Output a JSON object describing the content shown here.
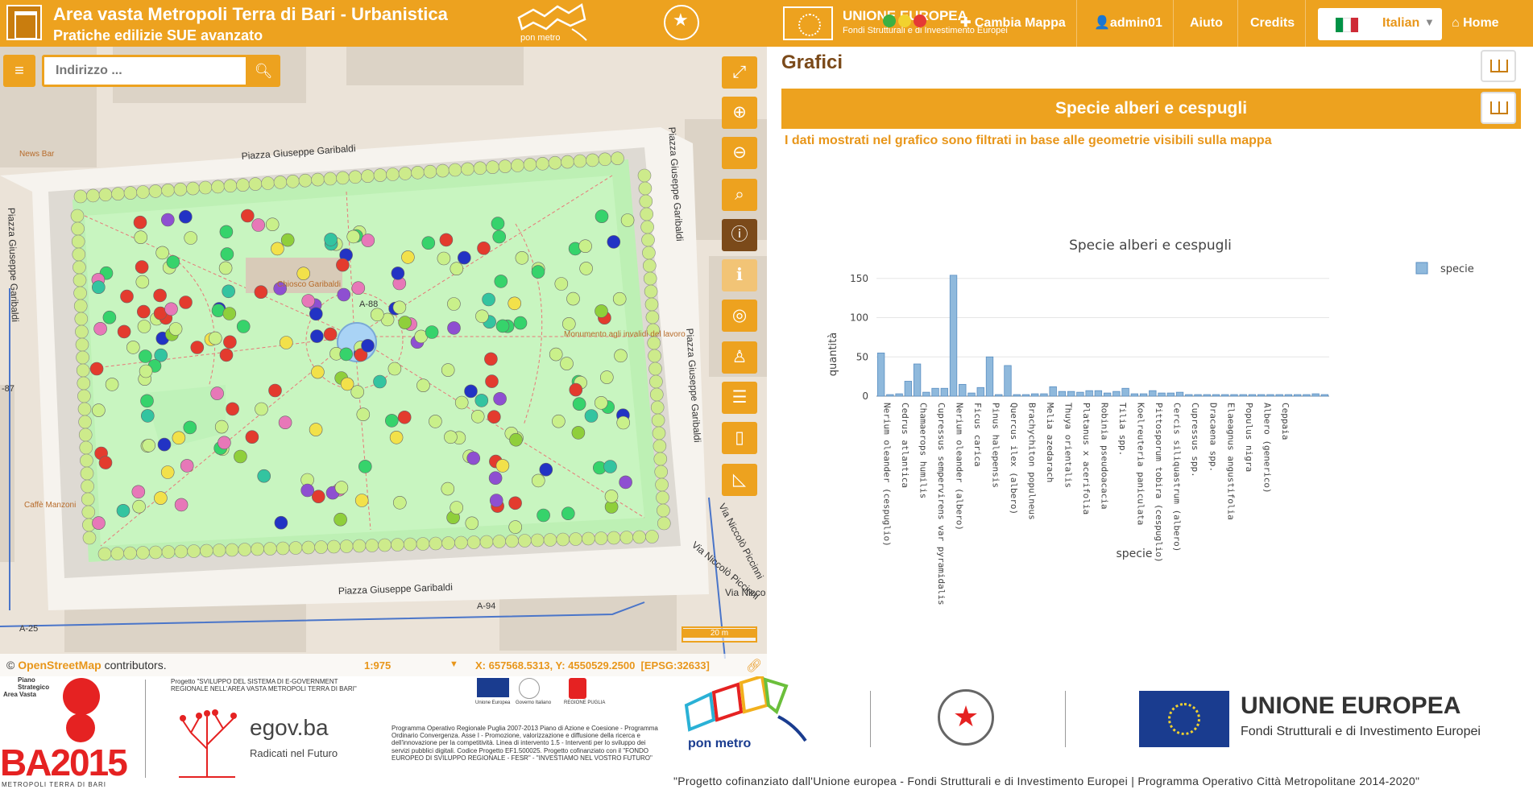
{
  "header": {
    "title": "Area vasta Metropoli Terra di Bari - Urbanistica",
    "subtitle": "Pratiche edilizie SUE avanzato",
    "ponmetro": "pon metro",
    "eu_title": "UNIONE EUROPEA",
    "eu_sub": "Fondi Strutturali e di Investimento Europei",
    "nav": {
      "cambia_mappa": "Cambia Mappa",
      "user": "admin01",
      "aiuto": "Aiuto",
      "credits": "Credits",
      "language": "Italian",
      "home": "Home"
    },
    "colors": {
      "accent": "#eda21f",
      "brown": "#7b4a1a"
    }
  },
  "map": {
    "search_placeholder": "Indirizzo ...",
    "attribution_prefix": "©",
    "attribution_link": "OpenStreetMap",
    "attribution_suffix": "contributors.",
    "scale": "1:975",
    "coords": "X: 657568.5313, Y: 4550529.2500",
    "epsg": "[EPSG:32633]",
    "scalebar": "20 m",
    "labels": {
      "street_top": "Piazza Giuseppe Garibaldi",
      "street_bottom": "Piazza Giuseppe Garibaldi",
      "street_left": "Piazza Giuseppe Garibaldi",
      "street_right_top": "Piazza Giuseppe Garibaldi",
      "street_right": "Piazza Giuseppe Garibaldi",
      "street_piccinni": "Via Niccolò Piccinni",
      "street_piccinni2": "Via Niccolò Piccinni",
      "street_nic": "Via Nicco",
      "kiosk": "Chiosco Garibaldi",
      "monument": "Monumento agli invalidi del lavoro",
      "news_bar": "News Bar",
      "caffe": "Caffè Manzoni",
      "a88": "A-88",
      "a94": "A-94",
      "a25": "A-25",
      "a87": "-87"
    },
    "tools": [
      "fullscreen-icon",
      "zoom-in-icon",
      "zoom-out-icon",
      "zoom-extent-icon",
      "info-icon",
      "info-list-icon",
      "locate-icon",
      "street-view-icon",
      "layers-icon",
      "measure-length-icon",
      "measure-area-icon"
    ]
  },
  "panel": {
    "title": "Grafici",
    "banner": "Specie alberi e cespugli",
    "note": "I dati mostrati nel grafico sono filtrati in base alle geometrie visibili sulla mappa"
  },
  "chart_data": {
    "type": "bar",
    "title": "Specie alberi e cespugli",
    "xlabel": "specie",
    "ylabel": "quantità",
    "ylim": [
      0,
      160
    ],
    "yticks": [
      0,
      50,
      100,
      150
    ],
    "grid": true,
    "legend": "top-right",
    "bar_color": "#8fb9dc",
    "series": [
      {
        "name": "specie"
      }
    ],
    "categories": [
      "Nerium oleander (cespuglio)",
      "",
      "Cedrus atlantica",
      "",
      "Chamaerops humilis",
      "",
      "Cupressus sempervirens var pyramidalis",
      "",
      "Nerium oleander (albero)",
      "",
      "Ficus carica",
      "",
      "Pinus halepensis",
      "",
      "Quercus ilex (albero)",
      "",
      "Brachychiton populneus",
      "",
      "Melia azedarach",
      "",
      "Thuya orientalis",
      "",
      "Platanus x acerifolia",
      "",
      "Robinia pseudoacacia",
      "",
      "Tilia spp.",
      "",
      "Koelreuteria paniculata",
      "",
      "Pittosporum tobira (cespuglio)",
      "",
      "Cercis siliquastrum (albero)",
      "",
      "Cupressus spp.",
      "",
      "Dracaena spp.",
      "",
      "Elaeagnus angustifolia",
      "",
      "Populus nigra",
      "",
      "Albero (generico)",
      "",
      "Ceppaia",
      ""
    ],
    "values": [
      55,
      2,
      3,
      19,
      41,
      5,
      10,
      10,
      154,
      15,
      4,
      11,
      50,
      2,
      39,
      2,
      2,
      3,
      3,
      12,
      6,
      6,
      5,
      7,
      7,
      4,
      6,
      10,
      3,
      3,
      7,
      4,
      4,
      5,
      2,
      2,
      2,
      2,
      2,
      2,
      2,
      2,
      2,
      2,
      2,
      2,
      2,
      2,
      3,
      2
    ]
  },
  "footer": {
    "plano1": "Piano",
    "plano2": "Strategico",
    "plano3": "Area Vasta",
    "ba2015": "BA2015",
    "metropoli": "METROPOLI TERRA DI BARI",
    "progetto": "Progetto \"SVILUPPO DEL SISTEMA DI E-GOVERNMENT REGIONALE NELL'AREA VASTA METROPOLI TERRA DI BARI\"",
    "egov": "egov.ba",
    "radicati": "Radicati nel Futuro",
    "ue_small": "Unione Europea",
    "gov_small": "Governo Italiano",
    "puglia_small": "REGIONE PUGLIA",
    "programma": "Programma Operativo Regionale Puglia 2007-2013 Piano di Azione e Coesione - Programma Ordinario Convergenza. Asse I - Promozione, valorizzazione e diffusione della ricerca e dell'innovazione per la competitività. Linea di intervento 1.5 - Interventi per lo sviluppo dei servizi pubblici digitali. Codice Progetto EF1.500025. Progetto cofinanziato con il \"FONDO EUROPEO DI SVILUPPO REGIONALE - FESR\" - \"INVESTIAMO NEL VOSTRO FUTURO\"",
    "ponmetro": "pon metro",
    "eu_title": "UNIONE EUROPEA",
    "eu_sub": "Fondi Strutturali e di Investimento Europei",
    "cofin": "\"Progetto cofinanziato dall'Unione europea - Fondi Strutturali e di Investimento Europei | Programma Operativo Città Metropolitane 2014-2020\""
  }
}
